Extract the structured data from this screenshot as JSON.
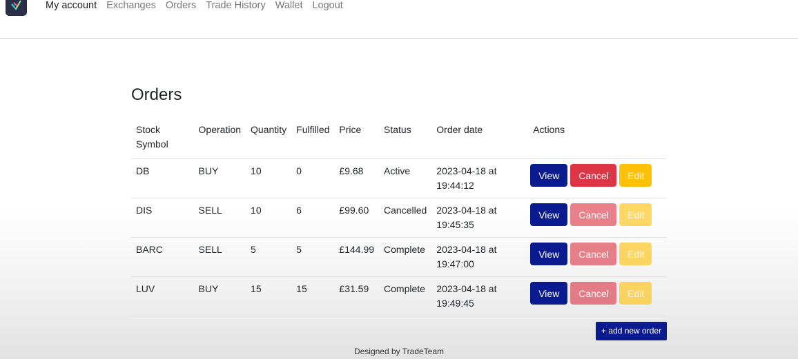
{
  "nav": {
    "links": [
      {
        "label": "My account",
        "active": true
      },
      {
        "label": "Exchanges",
        "active": false
      },
      {
        "label": "Orders",
        "active": false
      },
      {
        "label": "Trade History",
        "active": false
      },
      {
        "label": "Wallet",
        "active": false
      },
      {
        "label": "Logout",
        "active": false
      }
    ]
  },
  "page": {
    "title": "Orders"
  },
  "table": {
    "headers": {
      "symbol": "Stock Symbol",
      "operation": "Operation",
      "quantity": "Quantity",
      "fulfilled": "Fulfilled",
      "price": "Price",
      "status": "Status",
      "order_date": "Order date",
      "actions": "Actions"
    },
    "rows": [
      {
        "symbol": "DB",
        "operation": "BUY",
        "quantity": "10",
        "fulfilled": "0",
        "price": "£9.68",
        "status": "Active",
        "date_line1": "2023-04-18 at",
        "date_line2": "19:44:12",
        "actions_enabled": true
      },
      {
        "symbol": "DIS",
        "operation": "SELL",
        "quantity": "10",
        "fulfilled": "6",
        "price": "£99.60",
        "status": "Cancelled",
        "date_line1": "2023-04-18 at",
        "date_line2": "19:45:35",
        "actions_enabled": false
      },
      {
        "symbol": "BARC",
        "operation": "SELL",
        "quantity": "5",
        "fulfilled": "5",
        "price": "£144.99",
        "status": "Complete",
        "date_line1": "2023-04-18 at",
        "date_line2": "19:47:00",
        "actions_enabled": false
      },
      {
        "symbol": "LUV",
        "operation": "BUY",
        "quantity": "15",
        "fulfilled": "15",
        "price": "£31.59",
        "status": "Complete",
        "date_line1": "2023-04-18 at",
        "date_line2": "19:49:45",
        "actions_enabled": false
      }
    ]
  },
  "buttons": {
    "view": "View",
    "cancel": "Cancel",
    "edit": "Edit",
    "add_order": "+ add new order"
  },
  "footer": {
    "text": "Designed by TradeTeam"
  },
  "colors": {
    "primary": "#0a1a8f",
    "danger": "#dc3545",
    "warning": "#ffc107"
  },
  "icons": {
    "logo": "tradeteam-logo-icon"
  }
}
